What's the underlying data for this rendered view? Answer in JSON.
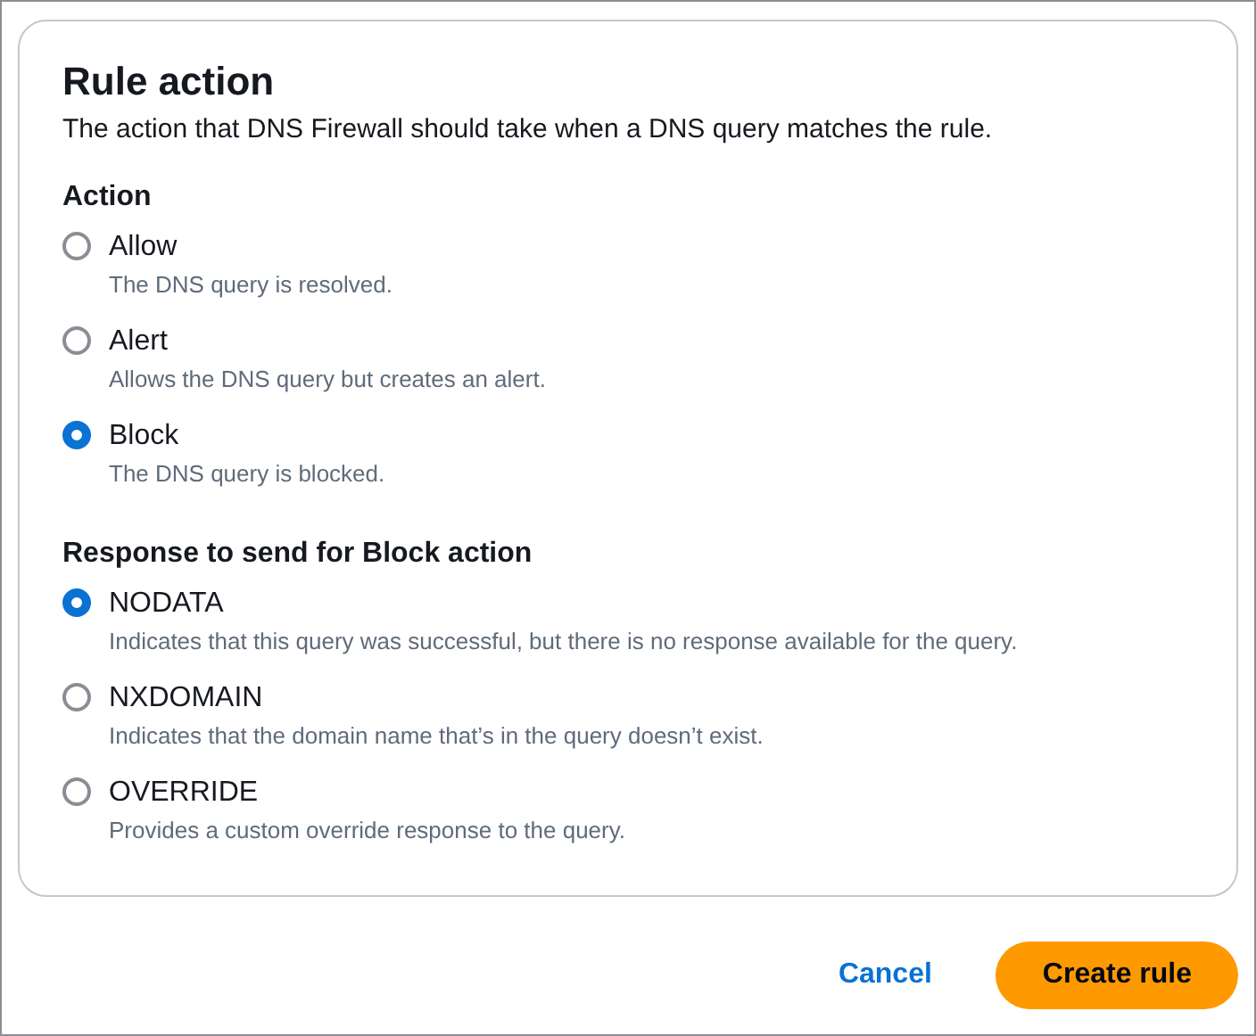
{
  "panel": {
    "title": "Rule action",
    "description": "The action that DNS Firewall should take when a DNS query matches the rule."
  },
  "groups": [
    {
      "label": "Action",
      "options": [
        {
          "label": "Allow",
          "description": "The DNS query is resolved.",
          "selected": false
        },
        {
          "label": "Alert",
          "description": "Allows the DNS query but creates an alert.",
          "selected": false
        },
        {
          "label": "Block",
          "description": "The DNS query is blocked.",
          "selected": true
        }
      ]
    },
    {
      "label": "Response to send for Block action",
      "options": [
        {
          "label": "NODATA",
          "description": "Indicates that this query was successful, but there is no response available for the query.",
          "selected": true
        },
        {
          "label": "NXDOMAIN",
          "description": "Indicates that the domain name that’s in the query doesn’t exist.",
          "selected": false
        },
        {
          "label": "OVERRIDE",
          "description": "Provides a custom override response to the query.",
          "selected": false
        }
      ]
    }
  ],
  "buttons": [
    {
      "label": "Cancel",
      "kind": "link"
    },
    {
      "label": "Create rule",
      "kind": "primary"
    }
  ]
}
